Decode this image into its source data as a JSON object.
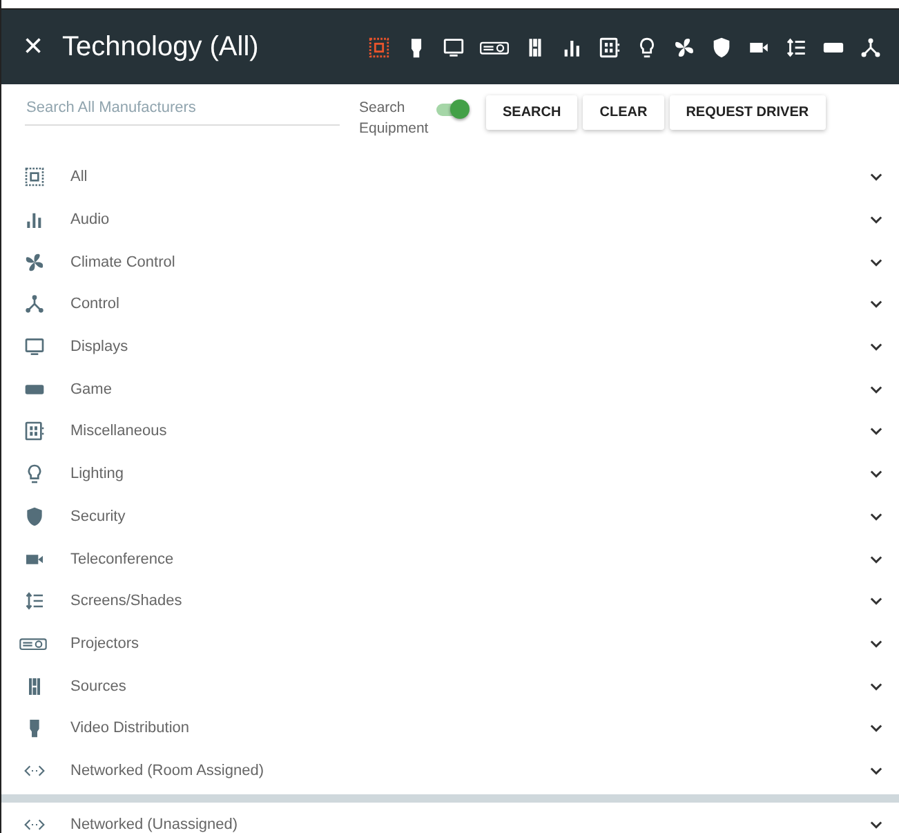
{
  "header": {
    "close": "×",
    "title": "Technology (All)",
    "filters": [
      {
        "kind": "all",
        "selected": true
      },
      {
        "kind": "video",
        "selected": false
      },
      {
        "kind": "display",
        "selected": false
      },
      {
        "kind": "projector",
        "selected": false
      },
      {
        "kind": "sources",
        "selected": false
      },
      {
        "kind": "audio",
        "selected": false
      },
      {
        "kind": "misc",
        "selected": false
      },
      {
        "kind": "lighting",
        "selected": false
      },
      {
        "kind": "climate",
        "selected": false
      },
      {
        "kind": "security",
        "selected": false
      },
      {
        "kind": "teleconference",
        "selected": false
      },
      {
        "kind": "shades",
        "selected": false
      },
      {
        "kind": "game",
        "selected": false
      },
      {
        "kind": "control",
        "selected": false
      }
    ]
  },
  "search": {
    "placeholder": "Search All Manufacturers",
    "toggle_label": "Search Equipment",
    "toggle_on": true,
    "buttons": [
      "SEARCH",
      "CLEAR",
      "REQUEST DRIVER"
    ]
  },
  "category_groups": [
    {
      "items": [
        {
          "kind": "all",
          "label": "All",
          "expanded": false
        },
        {
          "kind": "audio",
          "label": "Audio",
          "expanded": false
        },
        {
          "kind": "climate",
          "label": "Climate Control",
          "expanded": false
        },
        {
          "kind": "control",
          "label": "Control",
          "expanded": false
        },
        {
          "kind": "display",
          "label": "Displays",
          "expanded": false
        },
        {
          "kind": "game",
          "label": "Game",
          "expanded": false
        },
        {
          "kind": "misc",
          "label": "Miscellaneous",
          "expanded": false
        },
        {
          "kind": "lighting",
          "label": "Lighting",
          "expanded": false
        },
        {
          "kind": "security",
          "label": "Security",
          "expanded": false
        },
        {
          "kind": "teleconference",
          "label": "Teleconference",
          "expanded": false
        },
        {
          "kind": "shades",
          "label": "Screens/Shades",
          "expanded": false
        },
        {
          "kind": "projector",
          "label": "Projectors",
          "expanded": false
        },
        {
          "kind": "sources",
          "label": "Sources",
          "expanded": false
        },
        {
          "kind": "video",
          "label": "Video Distribution",
          "expanded": false
        },
        {
          "kind": "network",
          "label": "Networked (Room Assigned)",
          "expanded": false
        }
      ]
    },
    {
      "items": [
        {
          "kind": "network",
          "label": "Networked (Unassigned)",
          "expanded": false
        }
      ]
    }
  ]
}
